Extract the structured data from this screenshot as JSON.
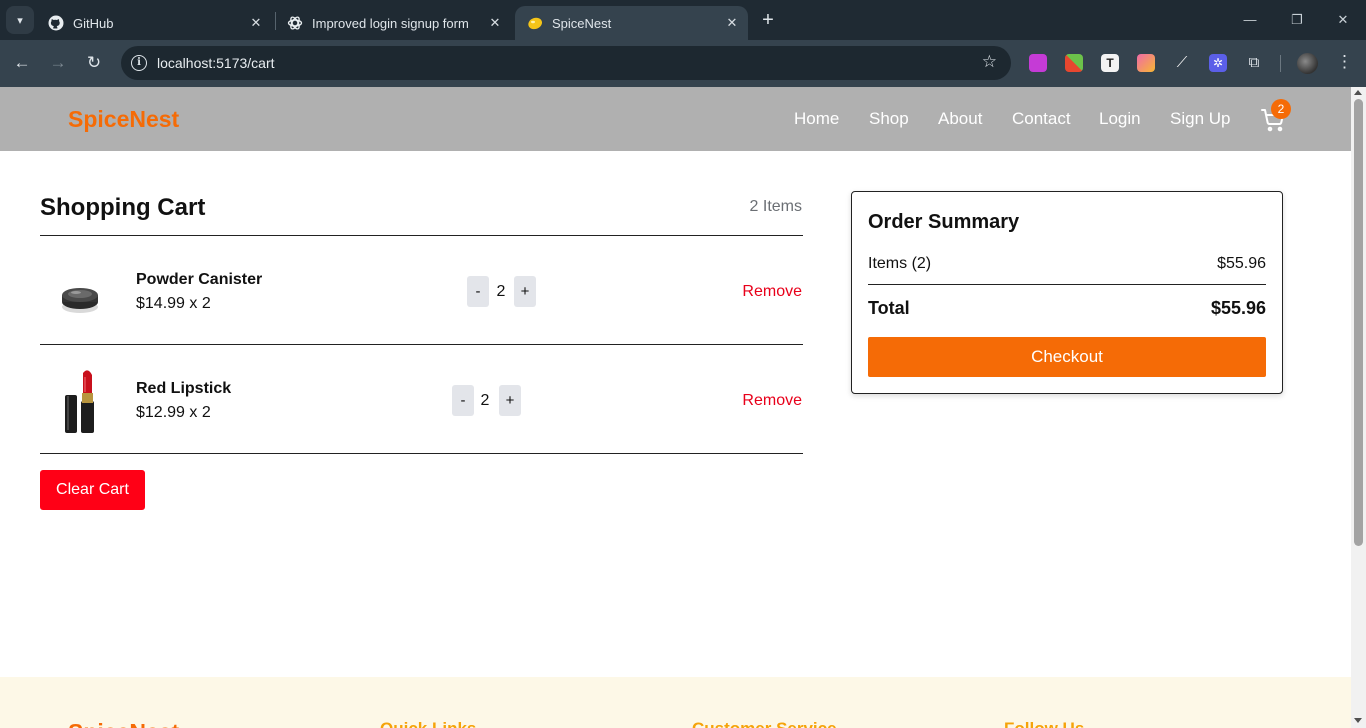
{
  "browser": {
    "tabs": [
      {
        "title": "GitHub",
        "icon": "github-icon"
      },
      {
        "title": "Improved login signup form",
        "icon": "openai-icon"
      },
      {
        "title": "SpiceNest",
        "icon": "spicenest-favicon",
        "active": true
      }
    ],
    "url": "localhost:5173/cart"
  },
  "site": {
    "brand": "SpiceNest",
    "nav": {
      "home": "Home",
      "shop": "Shop",
      "about": "About",
      "contact": "Contact",
      "login": "Login",
      "signup": "Sign Up"
    },
    "cart_badge": "2",
    "accent_color": "#f56b06"
  },
  "cart": {
    "title": "Shopping Cart",
    "count_label": "2 Items",
    "items": [
      {
        "name": "Powder Canister",
        "price_line": "$14.99 x 2",
        "quantity": "2",
        "remove": "Remove",
        "image": "powder-canister-image"
      },
      {
        "name": "Red Lipstick",
        "price_line": "$12.99 x 2",
        "quantity": "2",
        "remove": "Remove",
        "image": "red-lipstick-image"
      }
    ],
    "minus": "-",
    "plus": "+",
    "clear_label": "Clear Cart"
  },
  "summary": {
    "title": "Order Summary",
    "items_label": "Items (2)",
    "items_value": "$55.96",
    "total_label": "Total",
    "total_value": "$55.96",
    "checkout_label": "Checkout"
  },
  "footer": {
    "brand": "SpiceNest",
    "columns": [
      "Quick Links",
      "Customer Service",
      "Follow Us"
    ]
  }
}
